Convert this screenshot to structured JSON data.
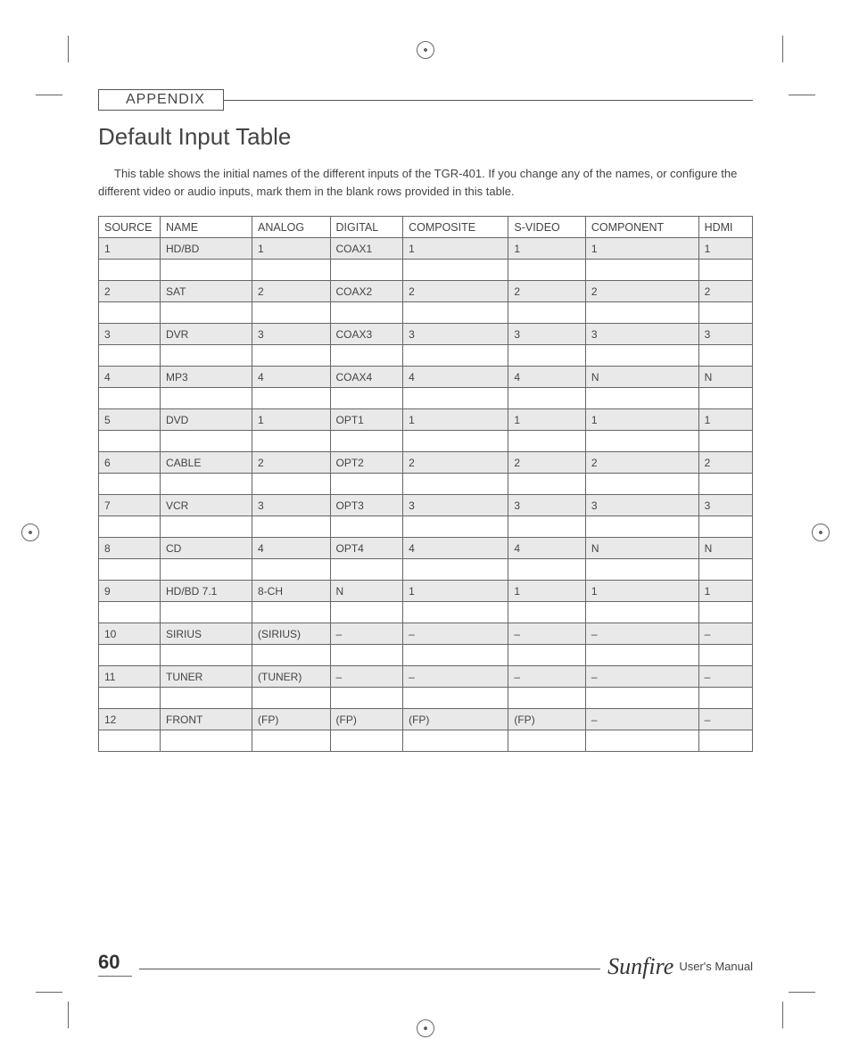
{
  "header": {
    "appendix_label": "APPENDIX",
    "title": "Default Input Table",
    "intro": "This table shows the initial names of the different inputs of the TGR-401. If you change any of the names, or configure the different video or audio inputs, mark them in the blank rows provided in this table."
  },
  "table": {
    "headers": [
      "SOURCE",
      "NAME",
      "ANALOG",
      "DIGITAL",
      "COMPOSITE",
      "S-VIDEO",
      "COMPONENT",
      "HDMI"
    ],
    "rows": [
      {
        "shaded": true,
        "cells": [
          "1",
          "HD/BD",
          "1",
          "COAX1",
          "1",
          "1",
          "1",
          "1"
        ]
      },
      {
        "shaded": false,
        "cells": [
          "",
          "",
          "",
          "",
          "",
          "",
          "",
          ""
        ]
      },
      {
        "shaded": true,
        "cells": [
          "2",
          "SAT",
          "2",
          "COAX2",
          "2",
          "2",
          "2",
          "2"
        ]
      },
      {
        "shaded": false,
        "cells": [
          "",
          "",
          "",
          "",
          "",
          "",
          "",
          ""
        ]
      },
      {
        "shaded": true,
        "cells": [
          "3",
          "DVR",
          "3",
          "COAX3",
          "3",
          "3",
          "3",
          "3"
        ]
      },
      {
        "shaded": false,
        "cells": [
          "",
          "",
          "",
          "",
          "",
          "",
          "",
          ""
        ]
      },
      {
        "shaded": true,
        "cells": [
          "4",
          "MP3",
          "4",
          "COAX4",
          "4",
          "4",
          "N",
          "N"
        ]
      },
      {
        "shaded": false,
        "cells": [
          "",
          "",
          "",
          "",
          "",
          "",
          "",
          ""
        ]
      },
      {
        "shaded": true,
        "cells": [
          "5",
          "DVD",
          "1",
          "OPT1",
          "1",
          "1",
          "1",
          "1"
        ]
      },
      {
        "shaded": false,
        "cells": [
          "",
          "",
          "",
          "",
          "",
          "",
          "",
          ""
        ]
      },
      {
        "shaded": true,
        "cells": [
          "6",
          "CABLE",
          "2",
          "OPT2",
          "2",
          "2",
          "2",
          "2"
        ]
      },
      {
        "shaded": false,
        "cells": [
          "",
          "",
          "",
          "",
          "",
          "",
          "",
          ""
        ]
      },
      {
        "shaded": true,
        "cells": [
          "7",
          "VCR",
          "3",
          "OPT3",
          "3",
          "3",
          "3",
          "3"
        ]
      },
      {
        "shaded": false,
        "cells": [
          "",
          "",
          "",
          "",
          "",
          "",
          "",
          ""
        ]
      },
      {
        "shaded": true,
        "cells": [
          "8",
          "CD",
          "4",
          "OPT4",
          "4",
          "4",
          "N",
          "N"
        ]
      },
      {
        "shaded": false,
        "cells": [
          "",
          "",
          "",
          "",
          "",
          "",
          "",
          ""
        ]
      },
      {
        "shaded": true,
        "cells": [
          "9",
          "HD/BD 7.1",
          "8-CH",
          "N",
          "1",
          "1",
          "1",
          "1"
        ]
      },
      {
        "shaded": false,
        "cells": [
          "",
          "",
          "",
          "",
          "",
          "",
          "",
          ""
        ]
      },
      {
        "shaded": true,
        "cells": [
          "10",
          "SIRIUS",
          "(SIRIUS)",
          "–",
          "–",
          "–",
          "–",
          "–"
        ]
      },
      {
        "shaded": false,
        "cells": [
          "",
          "",
          "",
          "",
          "",
          "",
          "",
          ""
        ]
      },
      {
        "shaded": true,
        "cells": [
          "11",
          "TUNER",
          "(TUNER)",
          "–",
          "–",
          "–",
          "–",
          "–"
        ]
      },
      {
        "shaded": false,
        "cells": [
          "",
          "",
          "",
          "",
          "",
          "",
          "",
          ""
        ]
      },
      {
        "shaded": true,
        "cells": [
          "12",
          "FRONT",
          "(FP)",
          "(FP)",
          "(FP)",
          "(FP)",
          "–",
          "–"
        ]
      },
      {
        "shaded": false,
        "cells": [
          "",
          "",
          "",
          "",
          "",
          "",
          "",
          ""
        ]
      }
    ]
  },
  "footer": {
    "page_number": "60",
    "brand": "Sunfire",
    "manual_label": "User's Manual"
  }
}
